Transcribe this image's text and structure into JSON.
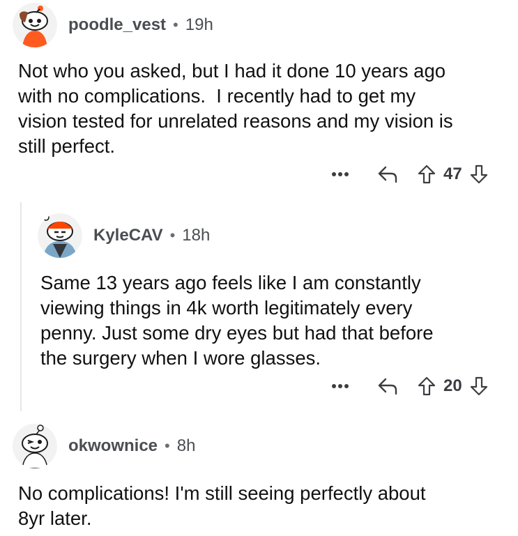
{
  "comments": [
    {
      "username": "poodle_vest",
      "separator": "•",
      "time": "19h",
      "text": "Not who you asked, but I had it done 10 years ago\nwith no complications.  I recently had to get my\nvision tested for unrelated reasons and my vision is\nstill perfect.",
      "score": "47"
    },
    {
      "username": "KyleCAV",
      "separator": "•",
      "time": "18h",
      "text": "Same 13 years ago feels like I am constantly\nviewing things in 4k worth legitimately every\npenny. Just some dry eyes but had that before\nthe surgery when I wore glasses.",
      "score": "20"
    },
    {
      "username": "okwownice",
      "separator": "•",
      "time": "8h",
      "text": "No complications! I'm still seeing perfectly about\n8yr later."
    }
  ],
  "icons": {
    "more": "more-options-icon",
    "reply": "reply-icon",
    "upvote": "upvote-icon",
    "downvote": "downvote-icon"
  },
  "colors": {
    "text": "#111111",
    "meta": "#4a4d52",
    "icon": "#3b3d40",
    "thread_line": "#e4e6e8",
    "avatar_orange": "#ff4500"
  }
}
